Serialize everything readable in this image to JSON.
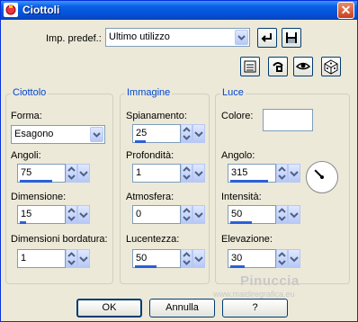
{
  "window": {
    "title": "Ciottoli",
    "close_glyph": "✕"
  },
  "preset": {
    "label": "Imp. predef.:",
    "value": "Ultimo utilizzo",
    "icons": [
      "apply-preset-icon",
      "save-preset-icon"
    ]
  },
  "toolbar_icons": [
    "reset-icon",
    "randomize-icon",
    "toggle-preview-icon",
    "random-icon"
  ],
  "ciottolo": {
    "title": "Ciottolo",
    "forma_label": "Forma:",
    "forma_value": "Esagono",
    "angoli_label": "Angoli:",
    "angoli_value": "75",
    "angoli_level": 0.75,
    "dimensione_label": "Dimensione:",
    "dimensione_value": "15",
    "dimensione_level": 0.15,
    "bordatura_label": "Dimensioni bordatura:",
    "bordatura_value": "1",
    "bordatura_level": 0.01
  },
  "immagine": {
    "title": "Immagine",
    "spianamento_label": "Spianamento:",
    "spianamento_value": "25",
    "spianamento_level": 0.25,
    "profondita_label": "Profondità:",
    "profondita_value": "1",
    "profondita_level": 0.01,
    "atmosfera_label": "Atmosfera:",
    "atmosfera_value": "0",
    "atmosfera_level": 0.0,
    "lucentezza_label": "Lucentezza:",
    "lucentezza_value": "50",
    "lucentezza_level": 0.5
  },
  "luce": {
    "title": "Luce",
    "colore_label": "Colore:",
    "colore_value": "#ffffff",
    "angolo_label": "Angolo:",
    "angolo_value": "315",
    "angolo_level": 0.875,
    "intensita_label": "Intensità:",
    "intensita_value": "50",
    "intensita_level": 0.5,
    "elevazione_label": "Elevazione:",
    "elevazione_value": "30",
    "elevazione_level": 0.33
  },
  "buttons": {
    "ok": "OK",
    "annulla": "Annulla",
    "help": "?"
  },
  "watermark": {
    "name": "Pinuccia",
    "url": "www.maidiregrafica.eu"
  },
  "colors": {
    "accent": "#0046d5",
    "bar": "#2b5fd8",
    "face": "#ece9d8"
  }
}
